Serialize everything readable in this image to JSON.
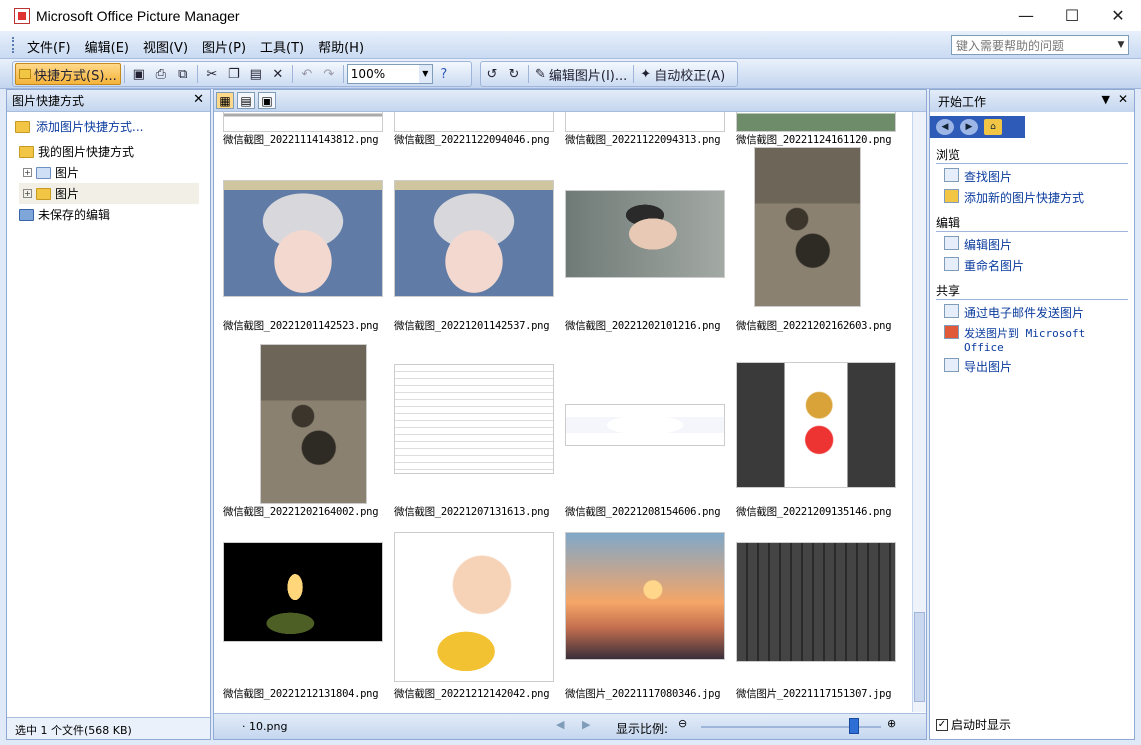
{
  "window": {
    "title": "Microsoft Office Picture Manager",
    "minimize": "—",
    "maximize": "☐",
    "close": "✕"
  },
  "menu": [
    "文件(F)",
    "编辑(E)",
    "视图(V)",
    "图片(P)",
    "工具(T)",
    "帮助(H)"
  ],
  "help_placeholder": "键入需要帮助的问题",
  "toolbar": {
    "shortcuts": "快捷方式(S)...",
    "zoom": "100%",
    "edit_pictures": "编辑图片(I)...",
    "auto_correct": "自动校正(A)"
  },
  "left_pane": {
    "title": "图片快捷方式",
    "add_link": "添加图片快捷方式...",
    "tree": {
      "root": "我的图片快捷方式",
      "child1": "图片",
      "child2": "图片",
      "unsaved": "未保存的编辑"
    },
    "status": "选中 1 个文件(568 KB)"
  },
  "thumbnails": [
    {
      "cap": "微信截图_20221114143812.png",
      "kind": "screen"
    },
    {
      "cap": "微信截图_20221122094046.png",
      "kind": "blank"
    },
    {
      "cap": "微信截图_20221122094313.png",
      "kind": "blank"
    },
    {
      "cap": "微信截图_20221124161120.png",
      "kind": "green"
    },
    {
      "cap": "微信截图_20221201142523.png",
      "kind": "portrait"
    },
    {
      "cap": "微信截图_20221201142537.png",
      "kind": "portrait"
    },
    {
      "cap": "微信截图_20221202101216.png",
      "kind": "girl"
    },
    {
      "cap": "微信截图_20221202162603.png",
      "kind": "sepia"
    },
    {
      "cap": "微信截图_20221202164002.png",
      "kind": "sepia"
    },
    {
      "cap": "微信截图_20221207131613.png",
      "kind": "doc"
    },
    {
      "cap": "微信截图_20221208154606.png",
      "kind": "logo"
    },
    {
      "cap": "微信截图_20221209135146.png",
      "kind": "editor"
    },
    {
      "cap": "微信截图_20221212131804.png",
      "kind": "candle"
    },
    {
      "cap": "微信截图_20221212142042.png",
      "kind": "cartoon"
    },
    {
      "cap": "微信图片_20221117080346.jpg",
      "kind": "sunset"
    },
    {
      "cap": "微信图片_20221117151307.jpg",
      "kind": "keyboard"
    }
  ],
  "bottom": {
    "file": "· 10.png",
    "zoom_label": "显示比例:",
    "zoom_level": 0.85
  },
  "right_pane": {
    "title": "开始工作",
    "browse": "浏览",
    "find": "查找图片",
    "add_new": "添加新的图片快捷方式",
    "edit": "编辑",
    "edit_pictures": "编辑图片",
    "rename": "重命名图片",
    "share": "共享",
    "email": "通过电子邮件发送图片",
    "send_office": "发送图片到 Microsoft Office",
    "export": "导出图片",
    "show_on_start": "启动时显示"
  }
}
